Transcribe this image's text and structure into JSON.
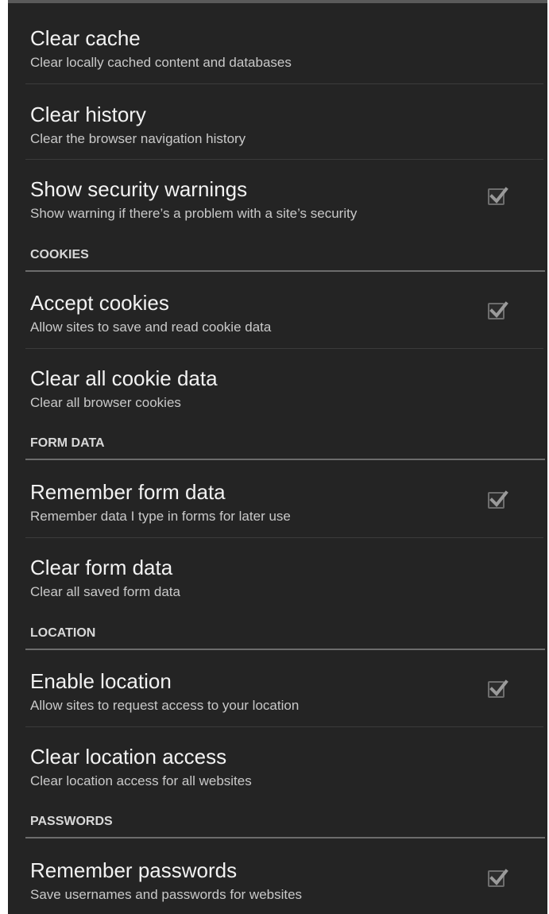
{
  "settings": {
    "clear_cache": {
      "title": "Clear cache",
      "summary": "Clear locally cached content and databases"
    },
    "clear_history": {
      "title": "Clear history",
      "summary": "Clear the browser navigation history"
    },
    "security_warnings": {
      "title": "Show security warnings",
      "summary": "Show warning if there’s a problem with a site’s security",
      "checked": true
    },
    "cookies_header": "COOKIES",
    "accept_cookies": {
      "title": "Accept cookies",
      "summary": "Allow sites to save and read cookie data",
      "checked": true
    },
    "clear_cookies": {
      "title": "Clear all cookie data",
      "summary": "Clear all browser cookies"
    },
    "form_data_header": "FORM DATA",
    "remember_form_data": {
      "title": "Remember form data",
      "summary": "Remember data I type in forms for later use",
      "checked": true
    },
    "clear_form_data": {
      "title": "Clear form data",
      "summary": "Clear all saved form data"
    },
    "location_header": "LOCATION",
    "enable_location": {
      "title": "Enable location",
      "summary": "Allow sites to request access to your location",
      "checked": true
    },
    "clear_location": {
      "title": "Clear location access",
      "summary": "Clear location access for all websites"
    },
    "passwords_header": "PASSWORDS",
    "remember_passwords": {
      "title": "Remember passwords",
      "summary": "Save usernames and passwords for websites",
      "checked": true
    }
  },
  "colors": {
    "background": "#242424",
    "title_text": "#f2f2f2",
    "summary_text": "#c9c9c9",
    "checkmark": "#9a9a9a"
  },
  "icons": {
    "checkbox": "check-icon"
  }
}
